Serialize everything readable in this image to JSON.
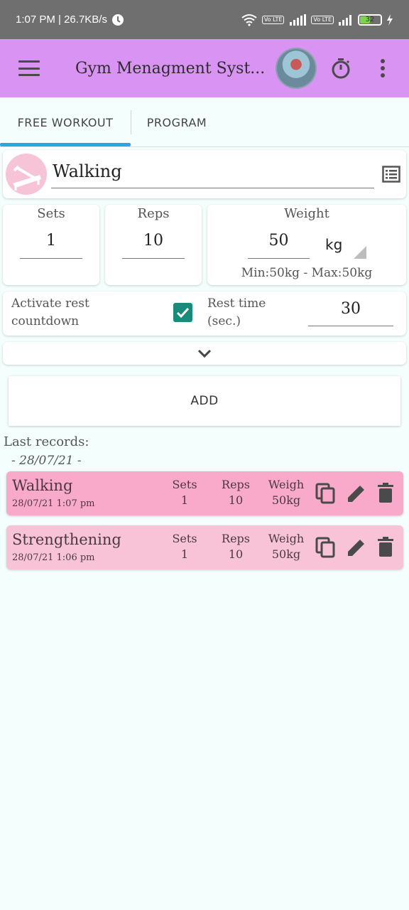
{
  "status_bar": {
    "time": "1:07 PM | 26.7KB/s",
    "network_badge_1": "Vo LTE",
    "network_badge_2": "Vo LTE",
    "battery": "32"
  },
  "app_bar": {
    "title": "Gym Menagment Syst..."
  },
  "tabs": [
    {
      "label": "FREE WORKOUT"
    },
    {
      "label": "PROGRAM"
    }
  ],
  "exercise": {
    "name": "Walking"
  },
  "sets": {
    "label": "Sets",
    "value": "1"
  },
  "reps": {
    "label": "Reps",
    "value": "10"
  },
  "weight": {
    "label": "Weight",
    "value": "50",
    "unit": "kg",
    "range": "Min:50kg - Max:50kg"
  },
  "rest": {
    "activate_label": "Activate rest countdown",
    "checked": true,
    "time_label": "Rest time (sec.)",
    "time_value": "30"
  },
  "add_button": "ADD",
  "records": {
    "heading": "Last records:",
    "date_separator": "- 28/07/21 -",
    "items": [
      {
        "name": "Walking",
        "datetime": "28/07/21  1:07 pm",
        "sets_label": "Sets",
        "sets": "1",
        "reps_label": "Reps",
        "reps": "10",
        "weight_label": "Weigh",
        "weight": "50kg"
      },
      {
        "name": "Strengthening",
        "datetime": "28/07/21  1:06 pm",
        "sets_label": "Sets",
        "sets": "1",
        "reps_label": "Reps",
        "reps": "10",
        "weight_label": "Weigh",
        "weight": "50kg"
      }
    ]
  },
  "colors": {
    "app_bar": "#d993f3",
    "tab_indicator": "#2aa7e0",
    "checkbox": "#1a8a7a",
    "record_1": "#f9a9c9",
    "record_2": "#f9c3d7"
  }
}
